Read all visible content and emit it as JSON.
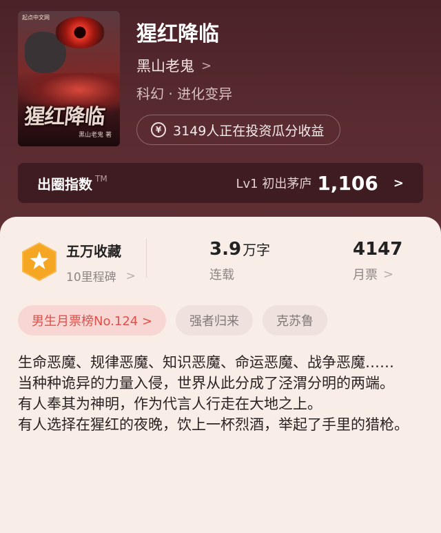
{
  "book": {
    "title": "猩红降临",
    "author": "黑山老鬼",
    "genre": "科幻 · 进化变异",
    "invest_text": "3149人正在投资瓜分收益",
    "cover": {
      "publisher": "起点中文网",
      "title": "猩红降临",
      "author": "黑山老鬼 著"
    }
  },
  "circle_index": {
    "label": "出圈指数",
    "tm": "TM",
    "level": "Lv1 初出茅庐",
    "score": "1,106"
  },
  "stats": {
    "collection": {
      "value": "五万收藏",
      "sub": "10里程碑"
    },
    "words": {
      "value": "3.9",
      "unit": "万字",
      "sub": "连载"
    },
    "monthly": {
      "value": "4147",
      "sub": "月票"
    }
  },
  "tags": [
    "男生月票榜No.124 >",
    "强者归来",
    "克苏鲁"
  ],
  "description": [
    "生命恶魔、规律恶魔、知识恶魔、命运恶魔、战争恶魔……",
    "当种种诡异的力量入侵，世界从此分成了泾渭分明的两端。",
    "有人奉其为神明，作为代言人行走在大地之上。",
    "有人选择在猩红的夜晚，饮上一杯烈酒，举起了手里的猎枪。"
  ],
  "colors": {
    "hero_bg": "#5a2c31",
    "accent_red": "#e0504a",
    "badge_orange": "#f5a623"
  },
  "icons": {
    "invest": "yen-icon",
    "badge": "star-hexagon-icon",
    "chevron": "chevron-right-icon"
  }
}
